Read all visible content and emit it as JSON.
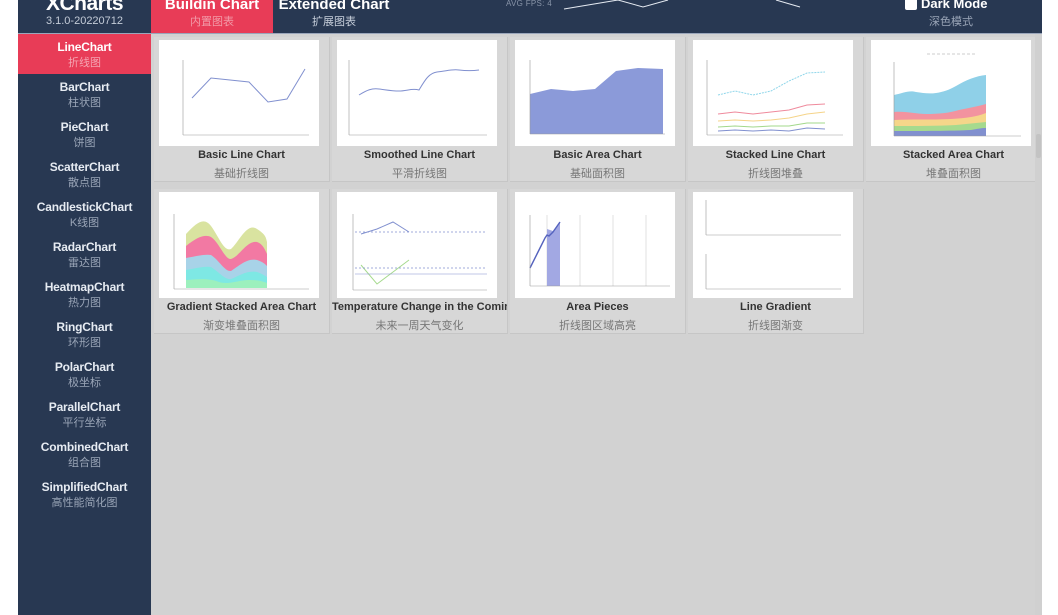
{
  "app": {
    "brand": "XCharts",
    "version": "3.1.0-20220712"
  },
  "header": {
    "tabs": [
      {
        "label": "Buildin Chart",
        "sublabel": "内置图表",
        "active": true
      },
      {
        "label": "Extended Chart",
        "sublabel": "扩展图表",
        "active": false
      }
    ],
    "fps": "AVG FPS: 4",
    "dark_mode": {
      "label": "Dark Mode",
      "sublabel": "深色模式",
      "checked": false
    }
  },
  "sidebar": {
    "items": [
      {
        "label": "LineChart",
        "sublabel": "折线图",
        "active": true
      },
      {
        "label": "BarChart",
        "sublabel": "柱状图"
      },
      {
        "label": "PieChart",
        "sublabel": "饼图"
      },
      {
        "label": "ScatterChart",
        "sublabel": "散点图"
      },
      {
        "label": "CandlestickChart",
        "sublabel": "K线图"
      },
      {
        "label": "RadarChart",
        "sublabel": "雷达图"
      },
      {
        "label": "HeatmapChart",
        "sublabel": "热力图"
      },
      {
        "label": "RingChart",
        "sublabel": "环形图"
      },
      {
        "label": "PolarChart",
        "sublabel": "极坐标"
      },
      {
        "label": "ParallelChart",
        "sublabel": "平行坐标"
      },
      {
        "label": "CombinedChart",
        "sublabel": "组合图"
      },
      {
        "label": "SimplifiedChart",
        "sublabel": "高性能简化图"
      }
    ]
  },
  "cards": [
    {
      "title": "Basic Line Chart",
      "subtitle": "基础折线图",
      "thumb": "basic-line"
    },
    {
      "title": "Smoothed Line Chart",
      "subtitle": "平滑折线图",
      "thumb": "smooth-line"
    },
    {
      "title": "Basic Area Chart",
      "subtitle": "基础面积图",
      "thumb": "basic-area"
    },
    {
      "title": "Stacked Line Chart",
      "subtitle": "折线图堆叠",
      "thumb": "stacked-line"
    },
    {
      "title": "Stacked Area Chart",
      "subtitle": "堆叠面积图",
      "thumb": "stacked-area"
    },
    {
      "title": "Gradient Stacked Area Chart",
      "subtitle": "渐变堆叠面积图",
      "thumb": "gradient-stacked-area"
    },
    {
      "title": "Temperature Change in the Coming",
      "subtitle": "未来一周天气变化",
      "thumb": "temperature"
    },
    {
      "title": "Area Pieces",
      "subtitle": "折线图区域高亮",
      "thumb": "area-pieces"
    },
    {
      "title": "Line Gradient",
      "subtitle": "折线图渐变",
      "thumb": "line-gradient"
    }
  ],
  "colors": {
    "accent": "#e83c57",
    "nav_bg": "#283852",
    "content_bg": "#d2d2d2"
  }
}
